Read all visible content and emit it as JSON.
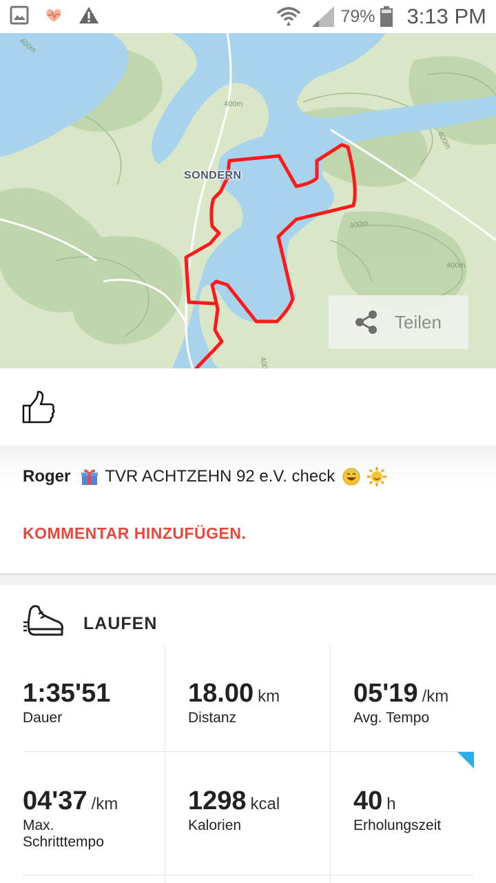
{
  "status_bar": {
    "battery_pct": "79%",
    "time": "3:13 PM",
    "icons": [
      "gallery-icon",
      "health-heart-icon",
      "warning-icon",
      "wifi-icon",
      "signal-icon",
      "battery-icon"
    ]
  },
  "map": {
    "place_label": "SONDERN",
    "share_label": "Teilen",
    "route_color": "#ff1a1a",
    "water_color": "#a8d3ec",
    "land_color": "#d9e6c8"
  },
  "like": {
    "icon": "thumbs-up-icon"
  },
  "comment": {
    "user": "Roger",
    "text": "TVR ACHTZEHN 92 e.V. check",
    "emojis": [
      "gift-emoji",
      "grinning-sweat-emoji",
      "sun-emoji"
    ],
    "add_comment_label": "KOMMENTAR HINZUFÜGEN."
  },
  "activity": {
    "type": "LAUFEN",
    "icon": "running-shoe-icon",
    "stats": [
      {
        "value": "1:35'51",
        "unit": "",
        "label": "Dauer"
      },
      {
        "value": "18.00",
        "unit": "km",
        "label": "Distanz"
      },
      {
        "value": "05'19",
        "unit": "/km",
        "label": "Avg. Tempo"
      },
      {
        "value": "04'37",
        "unit": "/km",
        "label": "Max. Schritttempo"
      },
      {
        "value": "1298",
        "unit": "kcal",
        "label": "Kalorien"
      },
      {
        "value": "40",
        "unit": "h",
        "label": "Erholungszeit"
      }
    ],
    "accent_color": "#2eaee8"
  }
}
